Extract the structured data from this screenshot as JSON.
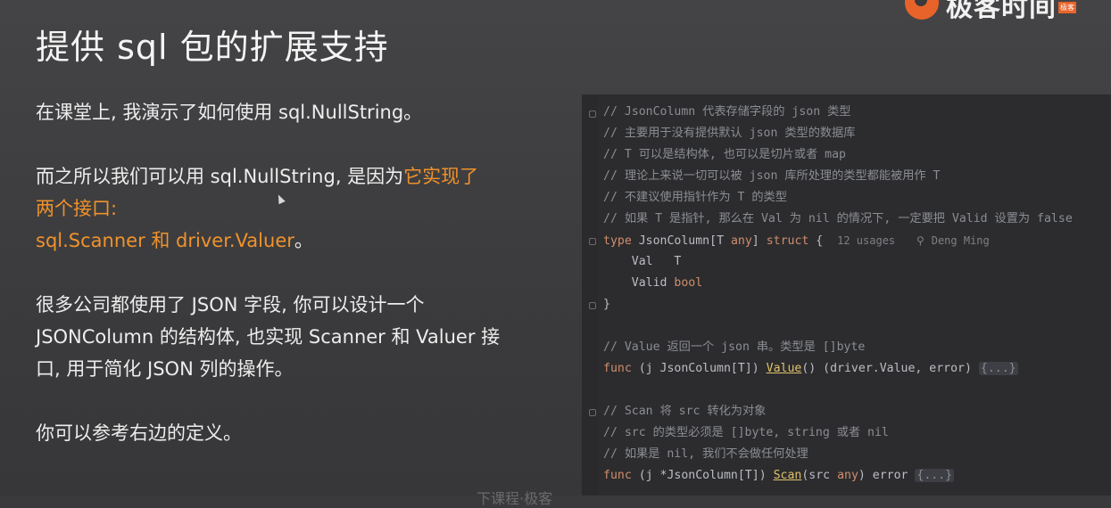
{
  "logo": {
    "text": "极客时间",
    "badge": "极客"
  },
  "title": "提供 sql 包的扩展支持",
  "left": {
    "p1": "在课堂上, 我演示了如何使用 sql.NullString。",
    "p2_a": "而之所以我们可以用 sql.NullString, 是因为",
    "p2_b": "它实现了",
    "p2_c": "两个接口:",
    "p2_d": "sql.Scanner 和 driver.Valuer",
    "p2_e": "。",
    "p3_a": "很多公司都使用了 JSON 字段, 你可以设计一个",
    "p3_b": "JSONColumn 的结构体, 也实现 Scanner 和 Valuer 接",
    "p3_c": "口, 用于简化 JSON 列的操作。",
    "p4": "你可以参考右边的定义。"
  },
  "code": {
    "c1": "// JsonColumn 代表存储字段的 json 类型",
    "c2": "// 主要用于没有提供默认 json 类型的数据库",
    "c3": "// T 可以是结构体, 也可以是切片或者 map",
    "c4": "// 理论上来说一切可以被 json 库所处理的类型都能被用作 T",
    "c5": "// 不建议使用指针作为 T 的类型",
    "c6": "// 如果 T 是指针, 那么在 Val 为 nil 的情况下, 一定要把 Valid 设置为 false",
    "type_kw": "type",
    "type_name": "JsonColumn",
    "type_param": "[T ",
    "type_any": "any",
    "type_close": "]",
    "struct_kw": "struct",
    "brace_open": "{",
    "usages": "12 usages",
    "author": "Deng Ming",
    "f1_name": "Val",
    "f1_type": "T",
    "f2_name": "Valid",
    "f2_type": "bool",
    "brace_close": "}",
    "c7": "// Value 返回一个 json 串。类型是 []byte",
    "func_kw": "func",
    "recv1": "(j JsonColumn[T])",
    "m1": "Value",
    "sig1": "() (driver.Value, error)",
    "folded": "{...}",
    "c8": "// Scan 将 src 转化为对象",
    "c9": "// src 的类型必须是 []byte, string 或者 nil",
    "c10": "// 如果是 nil, 我们不会做任何处理",
    "recv2": "(j *JsonColumn[T])",
    "m2": "Scan",
    "sig2_a": "(src ",
    "sig2_any": "any",
    "sig2_b": ") error"
  },
  "footer": "下课程·极客"
}
